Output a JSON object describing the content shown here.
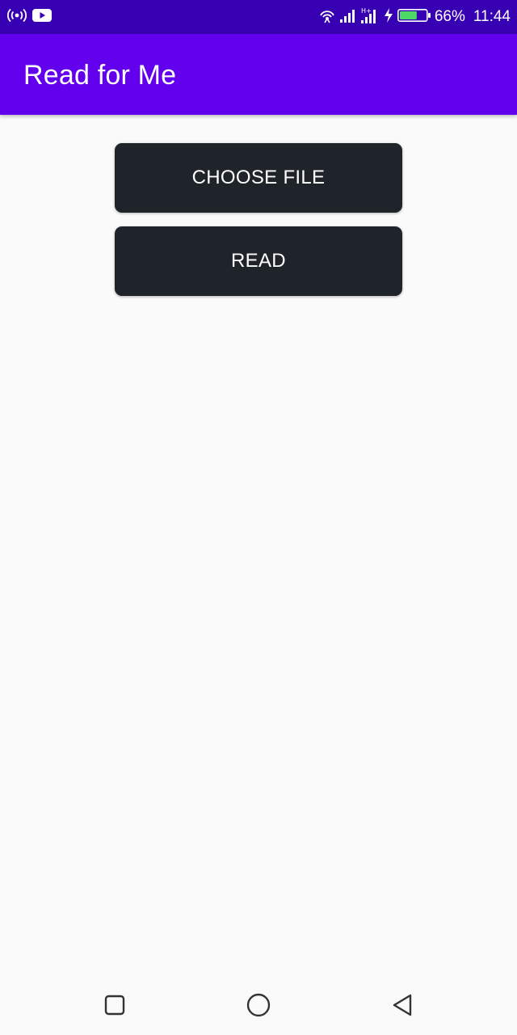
{
  "status_bar": {
    "battery_percent": "66%",
    "time": "11:44",
    "battery_level": 0.66,
    "icons": [
      "hotspot-icon",
      "youtube-icon",
      "wifi-icon",
      "signal-icon",
      "signal-h-plus-icon",
      "charging-icon",
      "battery-icon"
    ]
  },
  "app_bar": {
    "title": "Read for Me"
  },
  "main": {
    "choose_file_label": "CHOOSE FILE",
    "read_label": "READ"
  },
  "nav_bar": {
    "icons": [
      "recents-icon",
      "home-icon",
      "back-icon"
    ]
  },
  "colors": {
    "status_bar": "#3700b3",
    "app_bar": "#6200ee",
    "button": "#1f232a",
    "background": "#fafafa",
    "battery_fill": "#4cd964"
  }
}
